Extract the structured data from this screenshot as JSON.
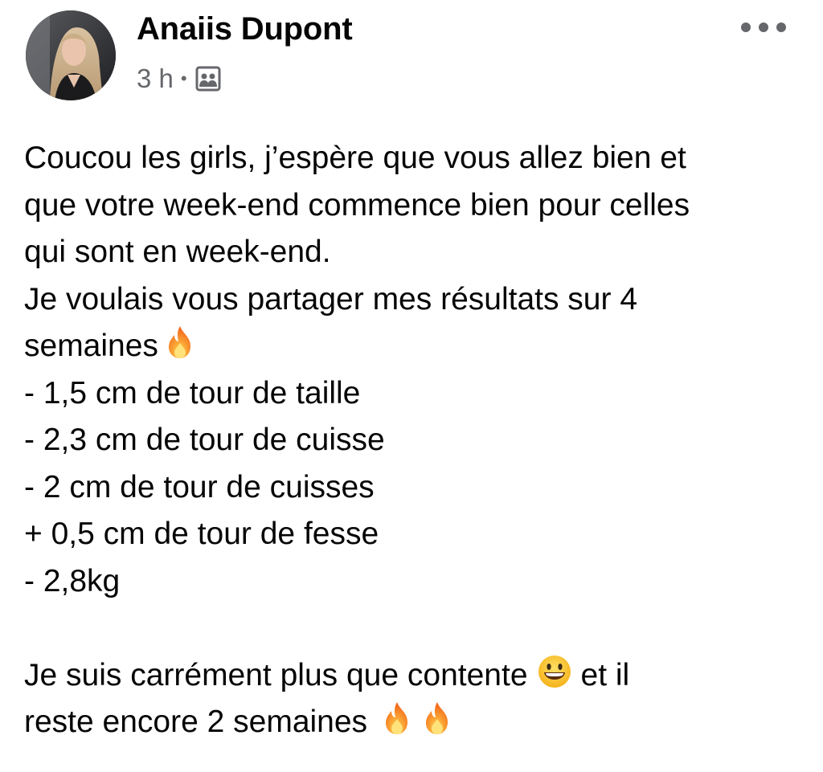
{
  "post": {
    "author": {
      "name": "Anaiis Dupont",
      "avatar_icon": "profile-photo"
    },
    "meta": {
      "time": "3 h",
      "separator": "•",
      "privacy_icon": "group-members-icon"
    },
    "more_icon": "more-horizontal-icon",
    "body": {
      "line1": "Coucou les girls, j’espère que vous allez bien et",
      "line2": "que votre week-end commence bien pour celles",
      "line3": "qui sont en week-end.",
      "line4": "Je voulais vous partager mes résultats sur 4",
      "line5": "semaines",
      "line6": "- 1,5 cm de tour de taille",
      "line7": "- 2,3 cm de tour de cuisse",
      "line8": "- 2 cm de tour de cuisses",
      "line9": "+ 0,5 cm de tour de fesse",
      "line10": "- 2,8kg",
      "line11a": "Je suis carrément plus que contente",
      "line11b": "et il",
      "line12": "reste encore 2 semaines"
    },
    "emojis": {
      "fire": "fire-emoji",
      "grin": "grinning-face-emoji"
    }
  }
}
